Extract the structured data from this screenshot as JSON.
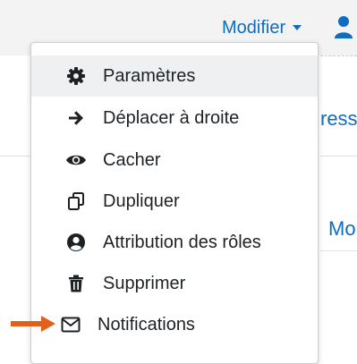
{
  "header": {
    "modifier_label": "Modifier"
  },
  "background": {
    "right_text_1": "ress",
    "right_text_2": "Mo"
  },
  "menu": {
    "items": [
      {
        "label": "Paramètres",
        "icon": "gear-icon"
      },
      {
        "label": "Déplacer à droite",
        "icon": "arrow-right-icon"
      },
      {
        "label": "Cacher",
        "icon": "eye-icon"
      },
      {
        "label": "Dupliquer",
        "icon": "copy-icon"
      },
      {
        "label": "Attribution des rôles",
        "icon": "user-circle-icon"
      },
      {
        "label": "Supprimer",
        "icon": "trash-icon"
      },
      {
        "label": "Notifications",
        "icon": "envelope-icon"
      }
    ]
  },
  "colors": {
    "link": "#0f6cbf",
    "text": "#1d2125",
    "hover_bg": "#eef0f2",
    "annotation_arrow": "#e0601c"
  }
}
